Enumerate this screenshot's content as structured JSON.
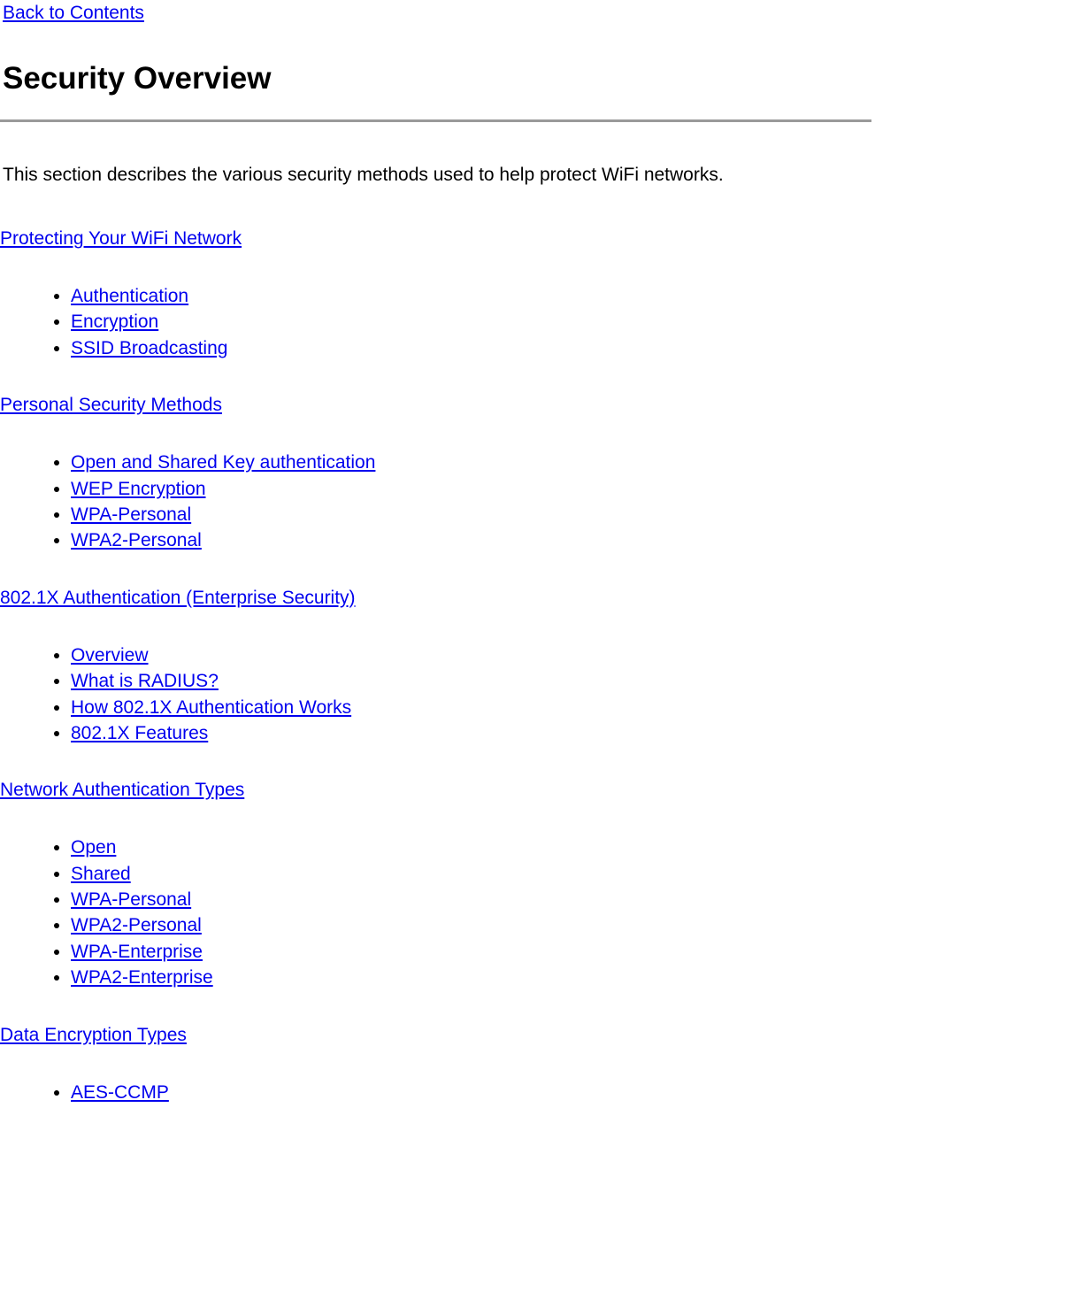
{
  "backLink": "Back to Contents",
  "title": "Security Overview",
  "intro": "This section describes the various security methods used to help protect WiFi networks.",
  "sections": [
    {
      "heading": "Protecting Your WiFi Network",
      "items": [
        "Authentication",
        "Encryption",
        "SSID Broadcasting"
      ]
    },
    {
      "heading": "Personal Security Methods ",
      "items": [
        "Open and Shared Key authentication",
        "WEP Encryption",
        "WPA-Personal",
        "WPA2-Personal"
      ]
    },
    {
      "heading": "802.1X Authentication (Enterprise Security) ",
      "items": [
        "Overview",
        "What is RADIUS?",
        "How 802.1X Authentication Works",
        "802.1X Features"
      ]
    },
    {
      "heading": "Network Authentication Types ",
      "items": [
        "Open",
        "Shared",
        "WPA-Personal ",
        "WPA2-Personal ",
        "WPA-Enterprise",
        "WPA2-Enterprise"
      ]
    },
    {
      "heading": "Data Encryption Types ",
      "items": [
        "AES-CCMP"
      ]
    }
  ]
}
